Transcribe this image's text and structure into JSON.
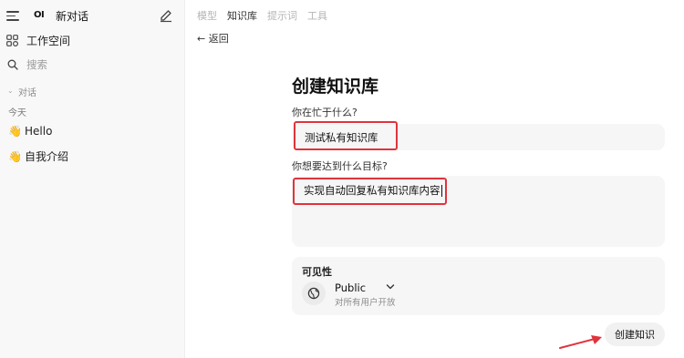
{
  "sidebar": {
    "logo": "OI",
    "new_chat": "新对话",
    "workspace": "工作空间",
    "search_placeholder": "搜索",
    "section_label": "对话",
    "today_label": "今天",
    "chats": [
      {
        "emoji": "👋",
        "title": "Hello"
      },
      {
        "emoji": "👋",
        "title": "自我介绍"
      }
    ]
  },
  "topnav": {
    "tabs": [
      {
        "label": "模型",
        "active": false
      },
      {
        "label": "知识库",
        "active": true
      },
      {
        "label": "提示词",
        "active": false
      },
      {
        "label": "工具",
        "active": false
      }
    ]
  },
  "back_label": "← 返回",
  "form": {
    "title": "创建知识库",
    "q1_label": "你在忙于什么?",
    "q1_value": "测试私有知识库",
    "q2_label": "你想要达到什么目标?",
    "q2_value": "实现自动回复私有知识库内容",
    "visibility": {
      "title": "可见性",
      "value": "Public",
      "description": "对所有用户开放",
      "icon": "globe-icon"
    },
    "create_button": "创建知识"
  },
  "colors": {
    "highlight_box": "#e0333c",
    "accent_arrow": "#e0333c"
  }
}
